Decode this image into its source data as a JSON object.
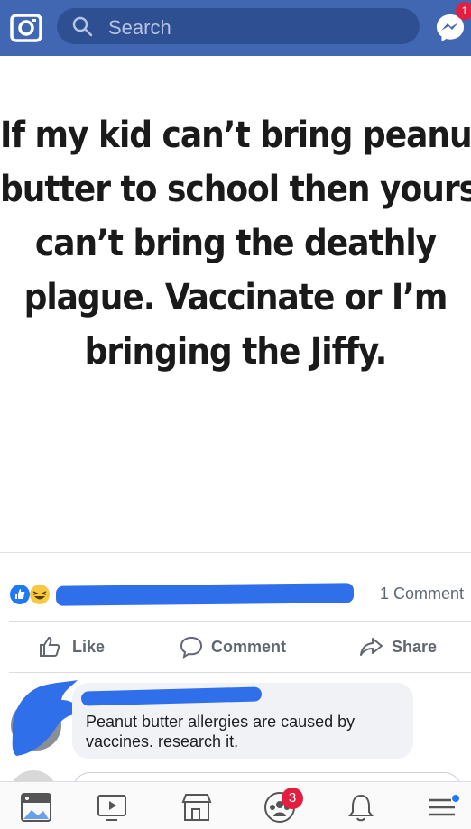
{
  "topbar": {
    "search_placeholder": "Search",
    "messenger_badge": "1",
    "bg_color": "#4267b2"
  },
  "post": {
    "meme_lines": [
      "If my kid can’t bring peanut",
      "butter to school then yours",
      "can’t bring the deathly",
      "plague. Vaccinate or I’m",
      "bringing the Jiffy."
    ],
    "comment_count": "1 Comment"
  },
  "actions": {
    "like": "Like",
    "comment": "Comment",
    "share": "Share"
  },
  "comment": {
    "text": "Peanut butter allergies are caused by vaccines. research it."
  },
  "tabbar": {
    "icons": [
      "news-feed-icon",
      "watch-icon",
      "marketplace-icon",
      "groups-icon",
      "notifications-icon",
      "menu-icon"
    ],
    "groups_badge": "3"
  }
}
